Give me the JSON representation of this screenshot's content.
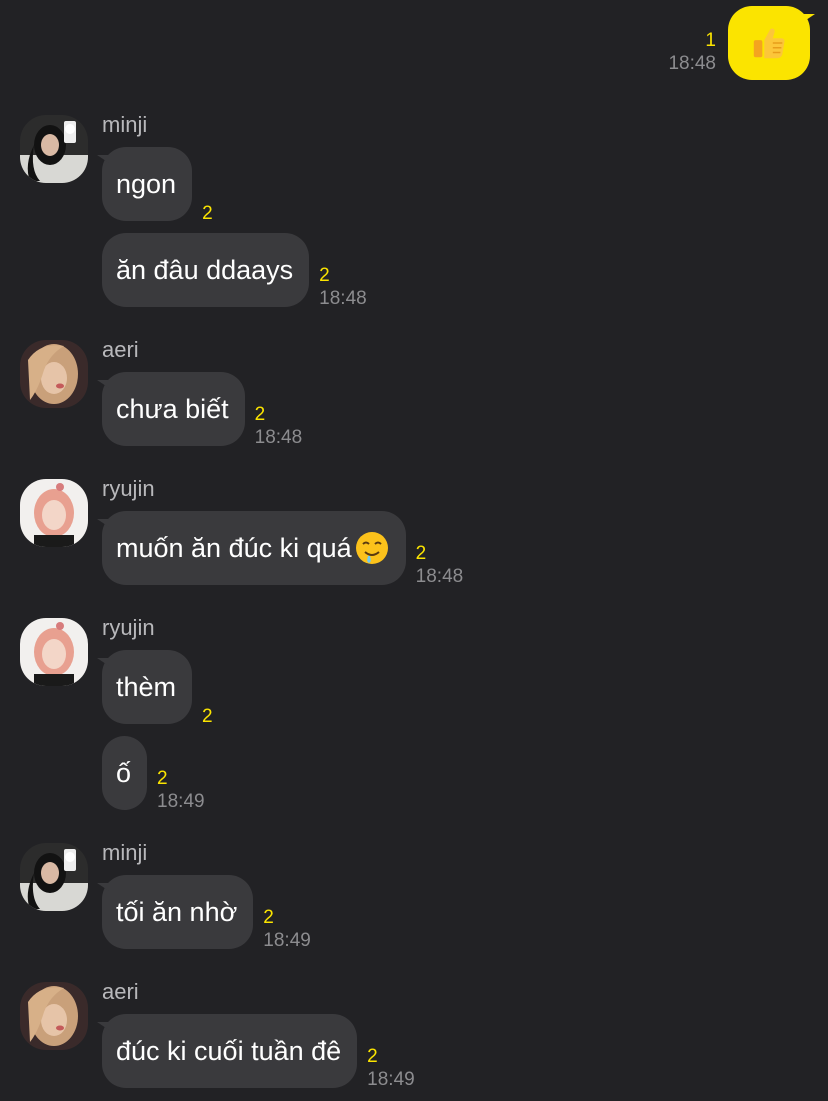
{
  "my_message": {
    "icon": "thumbs-up-icon",
    "unread": "1",
    "time": "18:48"
  },
  "groups": [
    {
      "sender": "minji",
      "avatar": "avatar-minji",
      "messages": [
        {
          "text": "ngon",
          "unread": "2",
          "time": ""
        },
        {
          "text": "ăn đâu ddaays",
          "unread": "2",
          "time": "18:48"
        }
      ]
    },
    {
      "sender": "aeri",
      "avatar": "avatar-aeri",
      "messages": [
        {
          "text": "chưa biết",
          "unread": "2",
          "time": "18:48"
        }
      ]
    },
    {
      "sender": "ryujin",
      "avatar": "avatar-ryujin",
      "messages": [
        {
          "text": "muốn ăn đúc ki quá",
          "emoji": "drooling-face-icon",
          "unread": "2",
          "time": "18:48"
        }
      ]
    },
    {
      "sender": "ryujin",
      "avatar": "avatar-ryujin",
      "messages": [
        {
          "text": "thèm",
          "unread": "2",
          "time": ""
        },
        {
          "text": "ố",
          "unread": "2",
          "time": "18:49"
        }
      ]
    },
    {
      "sender": "minji",
      "avatar": "avatar-minji",
      "messages": [
        {
          "text": "tối ăn nhờ",
          "unread": "2",
          "time": "18:49"
        }
      ]
    },
    {
      "sender": "aeri",
      "avatar": "avatar-aeri",
      "messages": [
        {
          "text": "đúc ki cuối tuần đê",
          "unread": "2",
          "time": "18:49"
        }
      ]
    }
  ]
}
